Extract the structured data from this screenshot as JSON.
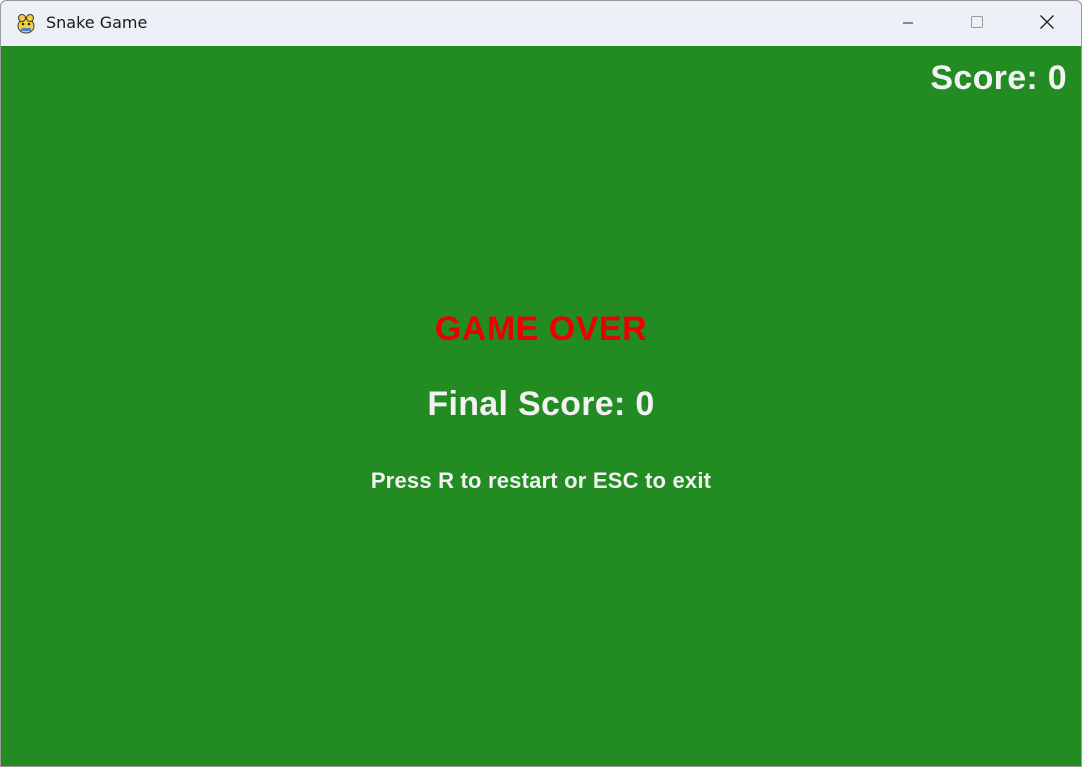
{
  "window": {
    "title": "Snake Game",
    "app_icon": "pygame-snake-icon",
    "controls": {
      "minimize_icon": "minimize-icon",
      "maximize_icon": "maximize-icon",
      "close_icon": "close-icon"
    }
  },
  "game": {
    "score_text": "Score: 0",
    "game_over_text": "GAME OVER",
    "final_score_text": "Final Score: 0",
    "instructions_text": "Press R to restart or ESC to exit"
  },
  "colors": {
    "background": "#228b22",
    "game_over": "#ee0000",
    "text": "#f2f2f2",
    "titlebar": "#eef0f8"
  }
}
